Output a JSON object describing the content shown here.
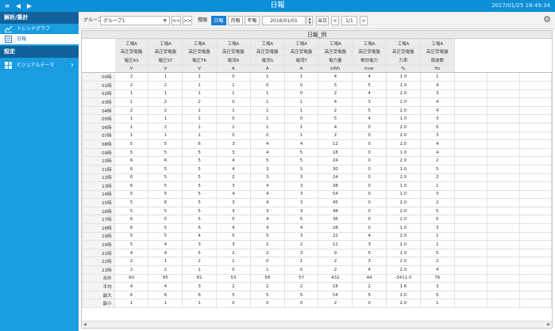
{
  "titlebar": {
    "nav_menu": "≡",
    "nav_back": "◀",
    "nav_forward": "▶",
    "title": "日報",
    "datetime": "2017/01/25 18:49:34"
  },
  "sidebar": {
    "section1": "解析/集計",
    "items1": [
      {
        "label": "トレンドグラフ",
        "icon": "trend-chart-icon"
      },
      {
        "label": "日報",
        "icon": "report-icon"
      }
    ],
    "section2": "設定",
    "items2": [
      {
        "label": "ビジュアルテーマ",
        "icon": "theme-icon"
      }
    ]
  },
  "toolbar": {
    "group_label": "グループ",
    "group_value": "グループ1",
    "prev_prev": "<<",
    "next_next": ">>",
    "mode_label": "種類",
    "modes": [
      "日報",
      "月報",
      "年報"
    ],
    "active_mode": "日報",
    "date": "2016/01/01",
    "today": "当日",
    "prev": "<",
    "page": "1/1",
    "next": ">"
  },
  "report": {
    "title": "日報_例",
    "header_row1": [
      "工場A",
      "工場A",
      "工場A",
      "工場A",
      "工場A",
      "工場A",
      "工場A",
      "工場A",
      "工場A",
      "工場A"
    ],
    "header_row2": [
      "高圧受電盤",
      "高圧受電盤",
      "高圧受電盤",
      "高圧受電盤",
      "高圧受電盤",
      "高圧受電盤",
      "高圧受電盤",
      "高圧受電盤",
      "高圧受電盤",
      "高圧受電盤"
    ],
    "header_row3": [
      "電圧RS",
      "電圧ST",
      "電圧TR",
      "電流R",
      "電流S",
      "電流T",
      "電力量",
      "無効電力",
      "力率",
      "周波数"
    ],
    "header_row4": [
      "V",
      "V",
      "V",
      "A",
      "A",
      "A",
      "kWh",
      "kvar",
      "%",
      "Hz"
    ],
    "rows": [
      {
        "label": "00時",
        "values": [
          "2",
          "1",
          "1",
          "0",
          "1",
          "1",
          "4",
          "4",
          "1.0",
          "1"
        ]
      },
      {
        "label": "01時",
        "values": [
          "2",
          "2",
          "1",
          "1",
          "0",
          "0",
          "5",
          "5",
          "1.0",
          "4"
        ]
      },
      {
        "label": "02時",
        "values": [
          "1",
          "1",
          "1",
          "1",
          "1",
          "0",
          "2",
          "4",
          "2.0",
          "3"
        ]
      },
      {
        "label": "03時",
        "values": [
          "1",
          "2",
          "2",
          "0",
          "1",
          "1",
          "4",
          "3",
          "2.0",
          "4"
        ]
      },
      {
        "label": "04時",
        "values": [
          "2",
          "2",
          "1",
          "1",
          "1",
          "1",
          "2",
          "5",
          "2.0",
          "4"
        ]
      },
      {
        "label": "05時",
        "values": [
          "1",
          "1",
          "1",
          "0",
          "1",
          "0",
          "5",
          "4",
          "1.0",
          "3"
        ]
      },
      {
        "label": "06時",
        "values": [
          "1",
          "2",
          "1",
          "1",
          "1",
          "1",
          "4",
          "0",
          "2.0",
          "5"
        ]
      },
      {
        "label": "07時",
        "values": [
          "1",
          "1",
          "1",
          "0",
          "0",
          "1",
          "2",
          "0",
          "2.0",
          "3"
        ]
      },
      {
        "label": "08時",
        "values": [
          "5",
          "5",
          "6",
          "3",
          "4",
          "4",
          "12",
          "0",
          "2.0",
          "4"
        ]
      },
      {
        "label": "09時",
        "values": [
          "5",
          "5",
          "5",
          "3",
          "4",
          "5",
          "18",
          "0",
          "1.0",
          "4"
        ]
      },
      {
        "label": "10時",
        "values": [
          "6",
          "6",
          "5",
          "4",
          "5",
          "5",
          "24",
          "0",
          "2.0",
          "2"
        ]
      },
      {
        "label": "11時",
        "values": [
          "6",
          "5",
          "5",
          "4",
          "3",
          "5",
          "30",
          "0",
          "1.0",
          "5"
        ]
      },
      {
        "label": "12時",
        "values": [
          "6",
          "5",
          "5",
          "2",
          "3",
          "3",
          "24",
          "0",
          "2.0",
          "2"
        ]
      },
      {
        "label": "13時",
        "values": [
          "6",
          "5",
          "5",
          "3",
          "4",
          "3",
          "38",
          "0",
          "1.0",
          "1"
        ]
      },
      {
        "label": "14時",
        "values": [
          "5",
          "5",
          "5",
          "4",
          "4",
          "3",
          "54",
          "0",
          "1.0",
          "3"
        ]
      },
      {
        "label": "15時",
        "values": [
          "5",
          "6",
          "5",
          "3",
          "4",
          "3",
          "45",
          "0",
          "2.0",
          "2"
        ]
      },
      {
        "label": "16時",
        "values": [
          "5",
          "5",
          "5",
          "3",
          "3",
          "3",
          "48",
          "0",
          "2.0",
          "5"
        ]
      },
      {
        "label": "17時",
        "values": [
          "6",
          "5",
          "5",
          "5",
          "4",
          "5",
          "36",
          "0",
          "2.0",
          "5"
        ]
      },
      {
        "label": "18時",
        "values": [
          "6",
          "5",
          "6",
          "4",
          "4",
          "4",
          "28",
          "0",
          "1.0",
          "3"
        ]
      },
      {
        "label": "19時",
        "values": [
          "5",
          "5",
          "4",
          "5",
          "5",
          "3",
          "22",
          "4",
          "2.0",
          "1"
        ]
      },
      {
        "label": "20時",
        "values": [
          "5",
          "4",
          "3",
          "3",
          "2",
          "2",
          "12",
          "3",
          "2.0",
          "1"
        ]
      },
      {
        "label": "21時",
        "values": [
          "4",
          "4",
          "5",
          "2",
          "2",
          "3",
          "9",
          "5",
          "1.0",
          "5"
        ]
      },
      {
        "label": "22時",
        "values": [
          "2",
          "1",
          "2",
          "1",
          "0",
          "1",
          "2",
          "3",
          "2.0",
          "2"
        ]
      },
      {
        "label": "23時",
        "values": [
          "2",
          "2",
          "1",
          "0",
          "1",
          "0",
          "2",
          "4",
          "2.0",
          "4"
        ]
      },
      {
        "label": "合計",
        "values": [
          "90",
          "85",
          "81",
          "53",
          "58",
          "57",
          "432",
          "44",
          "-3411.0",
          "76"
        ]
      },
      {
        "label": "平均",
        "values": [
          "4",
          "4",
          "3",
          "2",
          "2",
          "2",
          "18",
          "2",
          "1.6",
          "3"
        ]
      },
      {
        "label": "最大",
        "values": [
          "6",
          "6",
          "6",
          "5",
          "5",
          "5",
          "54",
          "5",
          "1.0",
          "5"
        ]
      },
      {
        "label": "最小",
        "values": [
          "1",
          "1",
          "1",
          "0",
          "0",
          "0",
          "2",
          "0",
          "2.0",
          "1"
        ]
      }
    ]
  },
  "colors": {
    "titlebar": "#0c8fd6",
    "sidebar": "#1a9de0",
    "sidebar_header": "#12619a",
    "active_button": "#1a7fd0"
  }
}
